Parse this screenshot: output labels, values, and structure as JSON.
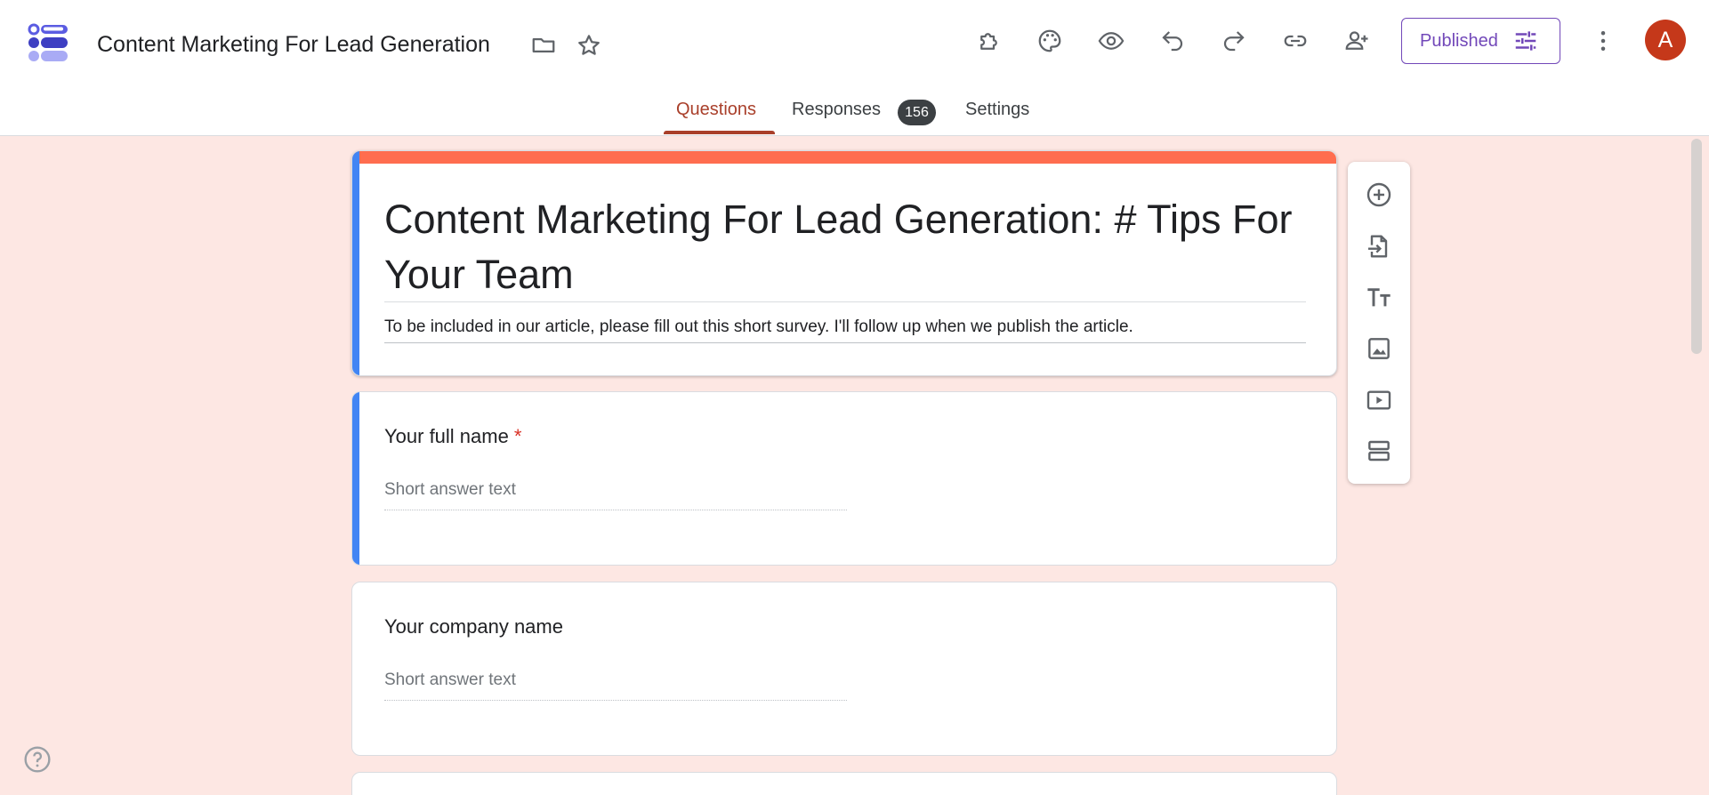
{
  "header": {
    "doc_title": "Content Marketing For Lead Generation",
    "published_label": "Published",
    "avatar_letter": "A"
  },
  "tabs": [
    {
      "label": "Questions",
      "active": true
    },
    {
      "label": "Responses",
      "badge": "156"
    },
    {
      "label": "Settings"
    }
  ],
  "form": {
    "title": "Content Marketing For Lead Generation: # Tips For Your Team",
    "description": "To be included in our article, please fill out this short survey. I'll follow up when we publish the article."
  },
  "questions": [
    {
      "title": "Your full name",
      "required_mark": "*",
      "placeholder": "Short answer text"
    },
    {
      "title": "Your company name",
      "placeholder": "Short answer text"
    }
  ],
  "icons": {
    "toolbar": [
      "addons-icon",
      "palette-icon",
      "preview-eye-icon",
      "undo-icon",
      "redo-icon",
      "link-icon",
      "add-collaborator-icon",
      "more-vert-icon"
    ],
    "side_toolbar": [
      "add-question-icon",
      "import-questions-icon",
      "add-title-icon",
      "add-image-icon",
      "add-video-icon",
      "add-section-icon"
    ]
  },
  "colors": {
    "accent": "#a93f2a",
    "theme_top": "#ff6d4f",
    "page_bg": "#fde7e3",
    "published": "#7248b9",
    "active_card": "#4285f4"
  }
}
